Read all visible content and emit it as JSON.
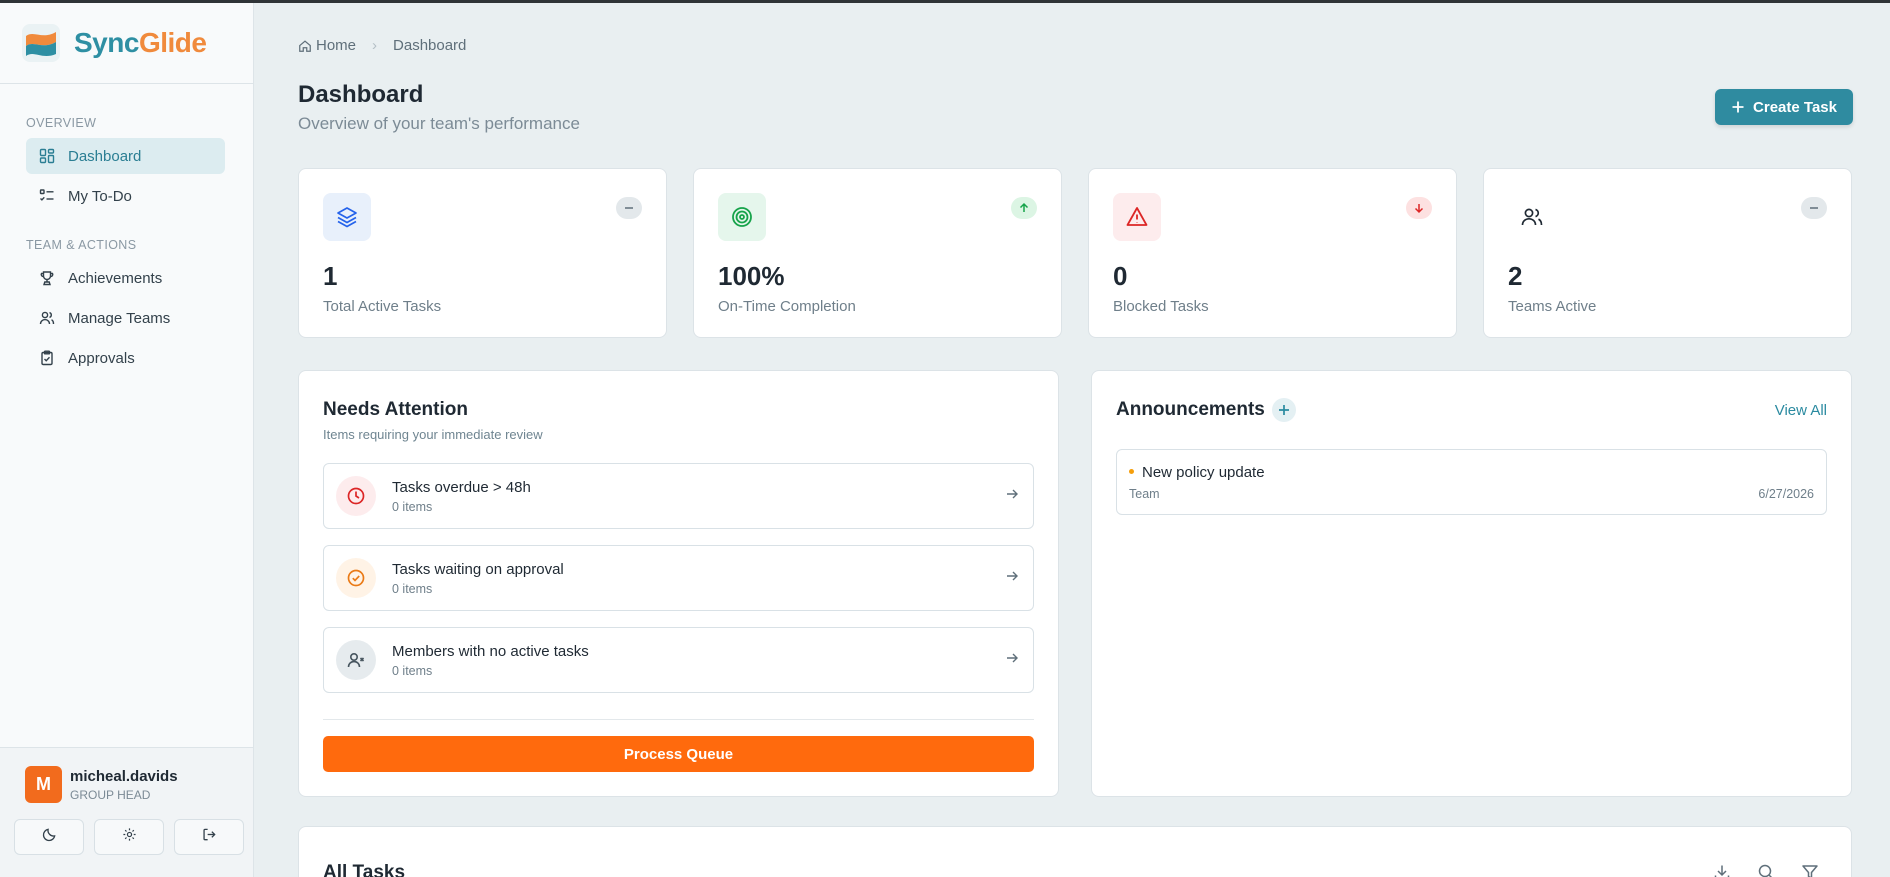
{
  "brand": {
    "part1": "Sync",
    "part2": "Glide"
  },
  "sidebar": {
    "sections": [
      {
        "label": "OVERVIEW"
      },
      {
        "label": "TEAM & ACTIONS"
      }
    ],
    "items": [
      {
        "label": "Dashboard",
        "icon": "dashboard-grid-icon",
        "active": true
      },
      {
        "label": "My To-Do",
        "icon": "checklist-icon"
      },
      {
        "label": "Achievements",
        "icon": "trophy-icon"
      },
      {
        "label": "Manage Teams",
        "icon": "users-icon"
      },
      {
        "label": "Approvals",
        "icon": "clipboard-check-icon"
      }
    ],
    "user": {
      "initial": "M",
      "name": "micheal.davids",
      "role": "GROUP HEAD"
    },
    "footer_buttons": [
      "moon-icon",
      "gear-icon",
      "logout-icon"
    ]
  },
  "breadcrumb": {
    "home": "Home",
    "current": "Dashboard"
  },
  "header": {
    "title": "Dashboard",
    "subtitle": "Overview of your team's performance",
    "create_label": "Create Task"
  },
  "stats": [
    {
      "value": "1",
      "label": "Total Active Tasks",
      "icon": "layers-icon",
      "trend": "neutral"
    },
    {
      "value": "100%",
      "label": "On-Time Completion",
      "icon": "target-icon",
      "trend": "up"
    },
    {
      "value": "0",
      "label": "Blocked Tasks",
      "icon": "warning-icon",
      "trend": "down"
    },
    {
      "value": "2",
      "label": "Teams Active",
      "icon": "users-icon",
      "trend": "neutral"
    }
  ],
  "attention": {
    "title": "Needs Attention",
    "subtitle": "Items requiring your immediate review",
    "items": [
      {
        "title": "Tasks overdue > 48h",
        "count": "0 items",
        "icon": "clock-icon"
      },
      {
        "title": "Tasks waiting on approval",
        "count": "0 items",
        "icon": "check-circle-icon"
      },
      {
        "title": "Members with no active tasks",
        "count": "0 items",
        "icon": "user-x-icon"
      }
    ],
    "button_label": "Process Queue"
  },
  "announcements": {
    "title": "Announcements",
    "view_all": "View All",
    "items": [
      {
        "title": "New policy update",
        "tag": "Team",
        "date": "6/27/2026"
      }
    ]
  },
  "all_tasks": {
    "title": "All Tasks"
  },
  "colors": {
    "accent": "#2f8ba0",
    "orange": "#ff6a0d",
    "danger": "#dc2626",
    "success": "#16a34a"
  }
}
